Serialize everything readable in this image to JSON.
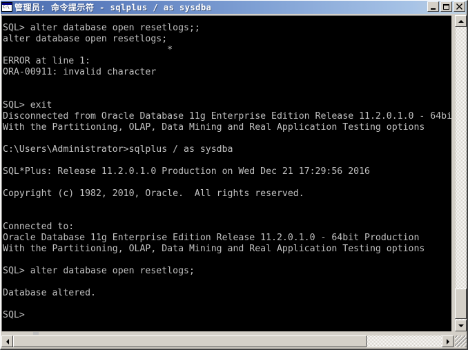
{
  "window": {
    "title": "管理员: 命令提示符 - sqlplus  / as sysdba",
    "icon_name": "console-icon",
    "icon_glyph": "C:\\",
    "controls": {
      "minimize_label": "_",
      "maximize_label": "□",
      "close_label": "✕"
    }
  },
  "console": {
    "background_color": "#000000",
    "text_color": "#c0c0c0",
    "prompt": "SQL>",
    "shell_prompt": "C:\\Users\\Administrator>",
    "cursor_visible": true,
    "lines": [
      "SQL> alter database open resetlogs;;",
      "alter database open resetlogs;",
      "                              *",
      "ERROR at line 1:",
      "ORA-00911: invalid character",
      "",
      "",
      "SQL> exit",
      "Disconnected from Oracle Database 11g Enterprise Edition Release 11.2.0.1.0 - 64bi",
      "With the Partitioning, OLAP, Data Mining and Real Application Testing options",
      "",
      "C:\\Users\\Administrator>sqlplus / as sysdba",
      "",
      "SQL*Plus: Release 11.2.0.1.0 Production on Wed Dec 21 17:29:56 2016",
      "",
      "Copyright (c) 1982, 2010, Oracle.  All rights reserved.",
      "",
      "",
      "Connected to:",
      "Oracle Database 11g Enterprise Edition Release 11.2.0.1.0 - 64bit Production",
      "With the Partitioning, OLAP, Data Mining and Real Application Testing options",
      "",
      "SQL> alter database open resetlogs;",
      "",
      "Database altered.",
      "",
      "SQL> "
    ],
    "text": "SQL> alter database open resetlogs;;\nalter database open resetlogs;\n                              *\nERROR at line 1:\nORA-00911: invalid character\n\n\nSQL> exit\nDisconnected from Oracle Database 11g Enterprise Edition Release 11.2.0.1.0 - 64bi\nWith the Partitioning, OLAP, Data Mining and Real Application Testing options\n\nC:\\Users\\Administrator>sqlplus / as sysdba\n\nSQL*Plus: Release 11.2.0.1.0 Production on Wed Dec 21 17:29:56 2016\n\nCopyright (c) 1982, 2010, Oracle.  All rights reserved.\n\n\nConnected to:\nOracle Database 11g Enterprise Edition Release 11.2.0.1.0 - 64bit Production\nWith the Partitioning, OLAP, Data Mining and Real Application Testing options\n\nSQL> alter database open resetlogs;\n\nDatabase altered.\n\nSQL> "
  },
  "scrollbars": {
    "vertical": {
      "up_arrow": "▲",
      "down_arrow": "▼",
      "thumb_position_percent": 90
    },
    "horizontal": {
      "left_arrow": "◄",
      "right_arrow": "►",
      "thumb_position_percent": 0
    }
  },
  "colors": {
    "titlebar_start": "#4d6fb0",
    "titlebar_end": "#c4d4e0",
    "chrome": "#d4d0c8",
    "console_bg": "#000000",
    "console_fg": "#c0c0c0"
  }
}
